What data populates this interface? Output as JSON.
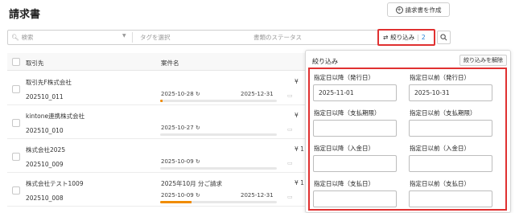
{
  "page": {
    "title": "請求書"
  },
  "create_button": {
    "label": "請求書を作成"
  },
  "filter_bar": {
    "search_placeholder": "検索",
    "tags_placeholder": "タグを選択",
    "status_placeholder": "書類のステータス",
    "refine_label": "絞り込み",
    "refine_count": "2"
  },
  "table": {
    "headers": {
      "client": "取引先",
      "case": "案件名"
    },
    "rows": [
      {
        "client": "取引先F株式会社",
        "code": "202510_011",
        "case": "",
        "date1": "2025-10-28",
        "date2": "2025-12-31",
        "amount": "¥",
        "progress": 0.02
      },
      {
        "client": "kintone連携株式会社",
        "code": "202510_010",
        "case": "",
        "date1": "2025-10-27",
        "date2": "",
        "amount": "¥",
        "progress": 0
      },
      {
        "client": "株式会社2025",
        "code": "202510_009",
        "case": "",
        "date1": "2025-10-09",
        "date2": "",
        "amount": "¥ 1",
        "progress": 0
      },
      {
        "client": "株式会社テスト1009",
        "code": "202510_008",
        "case": "2025年10月 分ご請求",
        "date1": "2025-10-09",
        "date2": "2025-12-31",
        "amount": "¥ 1",
        "progress": 0.27
      }
    ]
  },
  "refine_panel": {
    "title": "絞り込み",
    "clear_label": "絞り込みを解除",
    "fields": [
      {
        "label": "指定日以降（発行日）",
        "value": "2025-11-01"
      },
      {
        "label": "指定日以前（発行日）",
        "value": "2025-10-31"
      },
      {
        "label": "指定日以降（支払期限）",
        "value": ""
      },
      {
        "label": "指定日以前（支払期限）",
        "value": ""
      },
      {
        "label": "指定日以降（入金日）",
        "value": ""
      },
      {
        "label": "指定日以前（入金日）",
        "value": ""
      },
      {
        "label": "指定日以降（支払日）",
        "value": ""
      },
      {
        "label": "指定日以前（支払日）",
        "value": ""
      }
    ]
  },
  "colors": {
    "highlight": "#e03131",
    "accent": "#1c7ed6",
    "progress": "#f08c00"
  },
  "icons": {
    "plus": "plus-circle-icon",
    "search": "search-icon",
    "filter": "filter-sliders-icon",
    "history": "history-icon"
  }
}
